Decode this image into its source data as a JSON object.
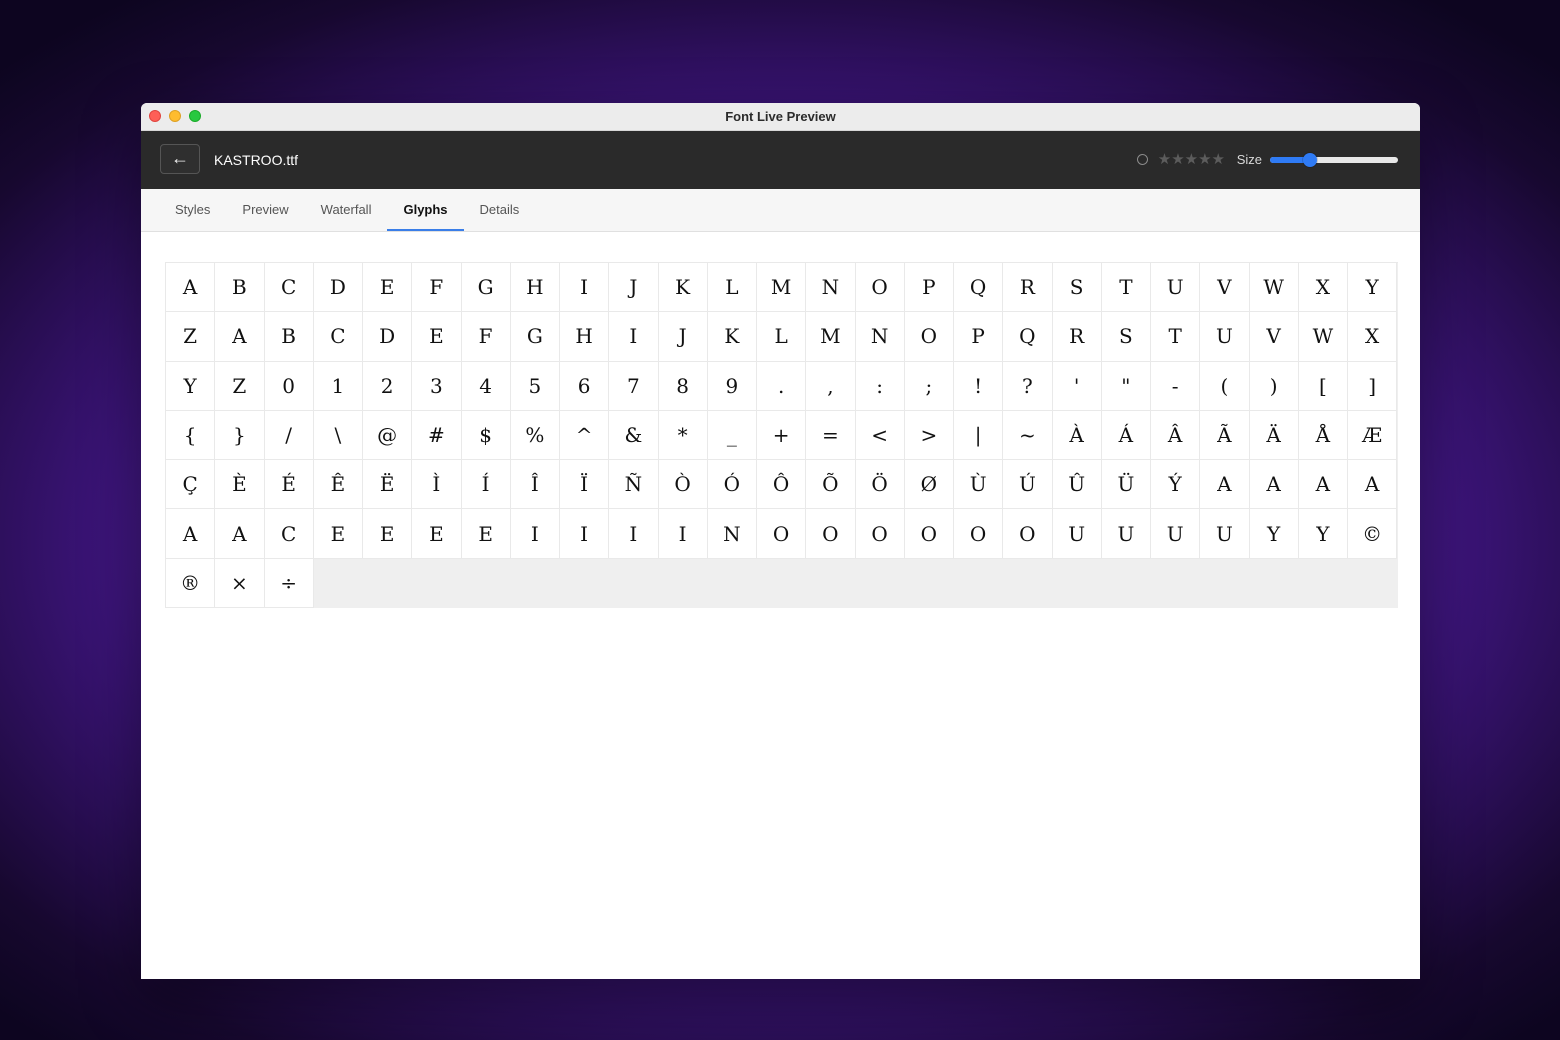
{
  "window": {
    "title": "Font Live Preview"
  },
  "toolbar": {
    "back_icon": "←",
    "file_name": "KASTROO.ttf",
    "rating": 0,
    "stars": "★★★★★",
    "size_label": "Size",
    "size_value_fraction": 0.31
  },
  "tabs": [
    {
      "label": "Styles",
      "active": false
    },
    {
      "label": "Preview",
      "active": false
    },
    {
      "label": "Waterfall",
      "active": false
    },
    {
      "label": "Glyphs",
      "active": true
    },
    {
      "label": "Details",
      "active": false
    }
  ],
  "glyphs": [
    "A",
    "B",
    "C",
    "D",
    "E",
    "F",
    "G",
    "H",
    "I",
    "J",
    "K",
    "L",
    "M",
    "N",
    "O",
    "P",
    "Q",
    "R",
    "S",
    "T",
    "U",
    "V",
    "W",
    "X",
    "Y",
    "Z",
    "A",
    "B",
    "C",
    "D",
    "E",
    "F",
    "G",
    "H",
    "I",
    "J",
    "K",
    "L",
    "M",
    "N",
    "O",
    "P",
    "Q",
    "R",
    "S",
    "T",
    "U",
    "V",
    "W",
    "X",
    "Y",
    "Z",
    "0",
    "1",
    "2",
    "3",
    "4",
    "5",
    "6",
    "7",
    "8",
    "9",
    ".",
    ",",
    ":",
    ";",
    "!",
    "?",
    "'",
    "\"",
    "-",
    "(",
    ")",
    "[",
    "]",
    "{",
    "}",
    "/",
    "\\",
    "@",
    "#",
    "$",
    "%",
    "^",
    "&",
    "*",
    "_",
    "+",
    "=",
    "<",
    ">",
    "|",
    "~",
    "À",
    "Á",
    "Â",
    "Ã",
    "Ä",
    "Å",
    "Æ",
    "Ç",
    "È",
    "É",
    "Ê",
    "Ë",
    "Ì",
    "Í",
    "Î",
    "Ï",
    "Ñ",
    "Ò",
    "Ó",
    "Ô",
    "Õ",
    "Ö",
    "Ø",
    "Ù",
    "Ú",
    "Û",
    "Ü",
    "Ý",
    "A",
    "A",
    "A",
    "A",
    "A",
    "A",
    "C",
    "E",
    "E",
    "E",
    "E",
    "I",
    "I",
    "I",
    "I",
    "N",
    "O",
    "O",
    "O",
    "O",
    "O",
    "O",
    "U",
    "U",
    "U",
    "U",
    "Y",
    "Y",
    "©",
    "®",
    "×",
    "÷"
  ]
}
